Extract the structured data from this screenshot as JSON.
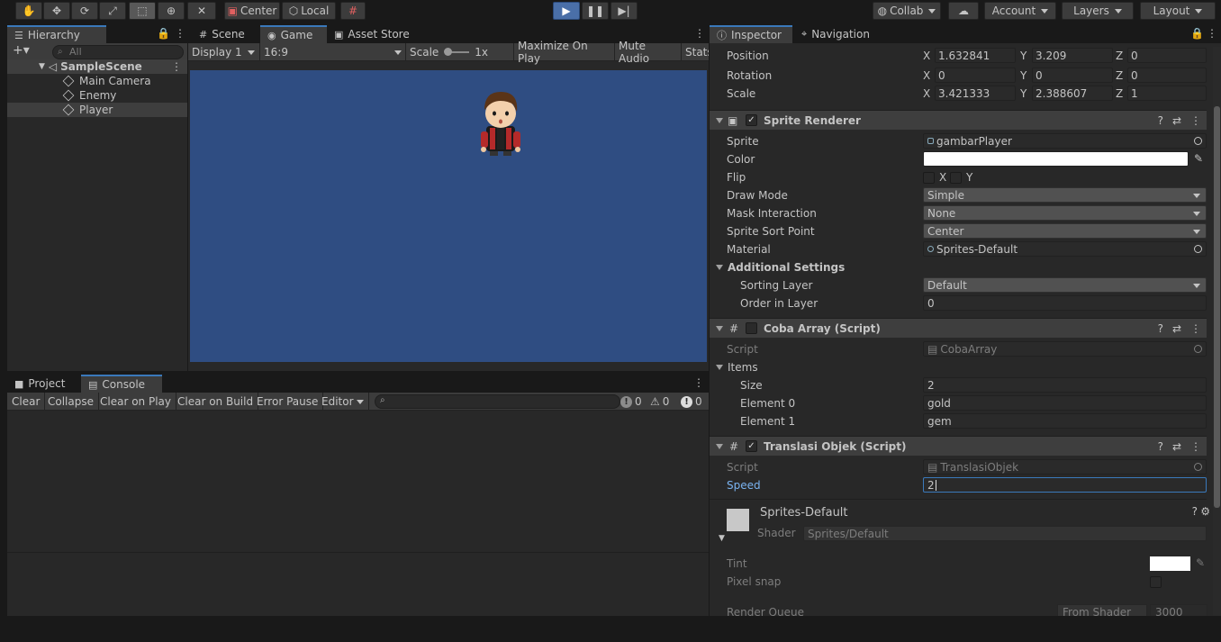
{
  "toolbar": {
    "pivot_label": "Center",
    "space_label": "Local",
    "collab_label": "Collab",
    "account_label": "Account",
    "layers_label": "Layers",
    "layout_label": "Layout"
  },
  "hierarchy": {
    "tab_label": "Hierarchy",
    "search_placeholder": "All",
    "scene_name": "SampleScene",
    "items": [
      {
        "label": "Main Camera"
      },
      {
        "label": "Enemy"
      },
      {
        "label": "Player"
      }
    ]
  },
  "center_tabs": {
    "scene": "Scene",
    "game": "Game",
    "asset_store": "Asset Store"
  },
  "game_toolbar": {
    "display": "Display 1",
    "aspect": "16:9",
    "scale_label": "Scale",
    "scale_value": "1x",
    "maximize": "Maximize On Play",
    "mute": "Mute Audio",
    "stats": "Stats"
  },
  "bottom_tabs": {
    "project": "Project",
    "console": "Console"
  },
  "console": {
    "clear": "Clear",
    "collapse": "Collapse",
    "clear_on_play": "Clear on Play",
    "clear_on_build": "Clear on Build",
    "error_pause": "Error Pause",
    "editor": "Editor",
    "log_count": "0",
    "warn_count": "0",
    "error_count": "0"
  },
  "inspector": {
    "tab_label": "Inspector",
    "nav_tab_label": "Navigation",
    "transform": {
      "position_label": "Position",
      "rotation_label": "Rotation",
      "scale_label": "Scale",
      "position": {
        "x": "1.632841",
        "y": "3.209",
        "z": "0"
      },
      "rotation": {
        "x": "0",
        "y": "0",
        "z": "0"
      },
      "scale": {
        "x": "3.421333",
        "y": "2.388607",
        "z": "1"
      }
    },
    "sprite_renderer": {
      "title": "Sprite Renderer",
      "sprite_label": "Sprite",
      "sprite_value": "gambarPlayer",
      "color_label": "Color",
      "flip_label": "Flip",
      "flip_x": "X",
      "flip_y": "Y",
      "draw_mode_label": "Draw Mode",
      "draw_mode_value": "Simple",
      "mask_label": "Mask Interaction",
      "mask_value": "None",
      "sort_point_label": "Sprite Sort Point",
      "sort_point_value": "Center",
      "material_label": "Material",
      "material_value": "Sprites-Default",
      "additional_label": "Additional Settings",
      "sorting_layer_label": "Sorting Layer",
      "sorting_layer_value": "Default",
      "order_label": "Order in Layer",
      "order_value": "0"
    },
    "coba_array": {
      "title": "Coba Array (Script)",
      "script_label": "Script",
      "script_value": "CobaArray",
      "items_label": "Items",
      "size_label": "Size",
      "size_value": "2",
      "el0_label": "Element 0",
      "el0_value": "gold",
      "el1_label": "Element 1",
      "el1_value": "gem"
    },
    "translasi": {
      "title": "Translasi Objek (Script)",
      "script_label": "Script",
      "script_value": "TranslasiObjek",
      "speed_label": "Speed",
      "speed_value": "2"
    },
    "material": {
      "name": "Sprites-Default",
      "shader_label": "Shader",
      "shader_value": "Sprites/Default",
      "tint_label": "Tint",
      "pixel_snap_label": "Pixel snap",
      "render_queue_label": "Render Queue",
      "render_queue_mode": "From Shader",
      "render_queue_value": "3000"
    }
  },
  "colors": {
    "game_background": "#2f4d82",
    "accent": "#3a79bb"
  }
}
